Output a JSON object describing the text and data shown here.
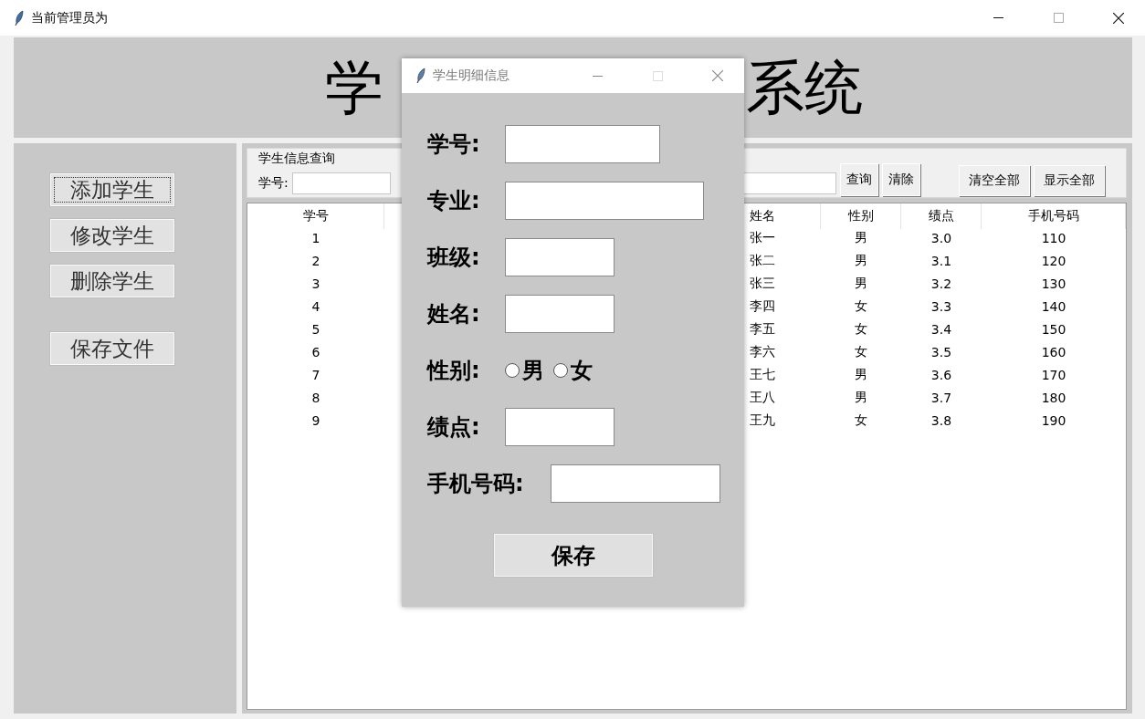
{
  "window": {
    "title": "当前管理员为"
  },
  "banner": {
    "title_parts": [
      "学",
      "系统"
    ]
  },
  "sidebar": {
    "buttons": [
      {
        "label": "添加学生",
        "focused": true
      },
      {
        "label": "修改学生",
        "focused": false
      },
      {
        "label": "删除学生",
        "focused": false
      },
      {
        "label": "保存文件",
        "focused": false
      }
    ]
  },
  "query": {
    "legend": "学生信息查询",
    "field_label": "学号:",
    "buttons": [
      "查询",
      "清除"
    ],
    "extra_buttons": [
      "清空全部",
      "显示全部"
    ]
  },
  "table": {
    "columns": [
      "学号",
      "姓名",
      "性别",
      "绩点",
      "手机号码"
    ],
    "rows": [
      [
        "1",
        "张一",
        "男",
        "3.0",
        "110"
      ],
      [
        "2",
        "张二",
        "男",
        "3.1",
        "120"
      ],
      [
        "3",
        "张三",
        "男",
        "3.2",
        "130"
      ],
      [
        "4",
        "李四",
        "女",
        "3.3",
        "140"
      ],
      [
        "5",
        "李五",
        "女",
        "3.4",
        "150"
      ],
      [
        "6",
        "李六",
        "女",
        "3.5",
        "160"
      ],
      [
        "7",
        "王七",
        "男",
        "3.6",
        "170"
      ],
      [
        "8",
        "王八",
        "男",
        "3.7",
        "180"
      ],
      [
        "9",
        "王九",
        "女",
        "3.8",
        "190"
      ]
    ]
  },
  "dialog": {
    "title": "学生明细信息",
    "fields": [
      {
        "kind": "text",
        "label": "学号:"
      },
      {
        "kind": "text",
        "label": "专业:"
      },
      {
        "kind": "text",
        "label": "班级:"
      },
      {
        "kind": "text",
        "label": "姓名:"
      },
      {
        "kind": "radio",
        "label": "性别:",
        "options": [
          {
            "label": "男",
            "selected": false
          },
          {
            "label": "女",
            "selected": false
          }
        ]
      },
      {
        "kind": "text",
        "label": "绩点:"
      },
      {
        "kind": "text",
        "label": "手机号码:"
      }
    ],
    "save": "保存"
  }
}
